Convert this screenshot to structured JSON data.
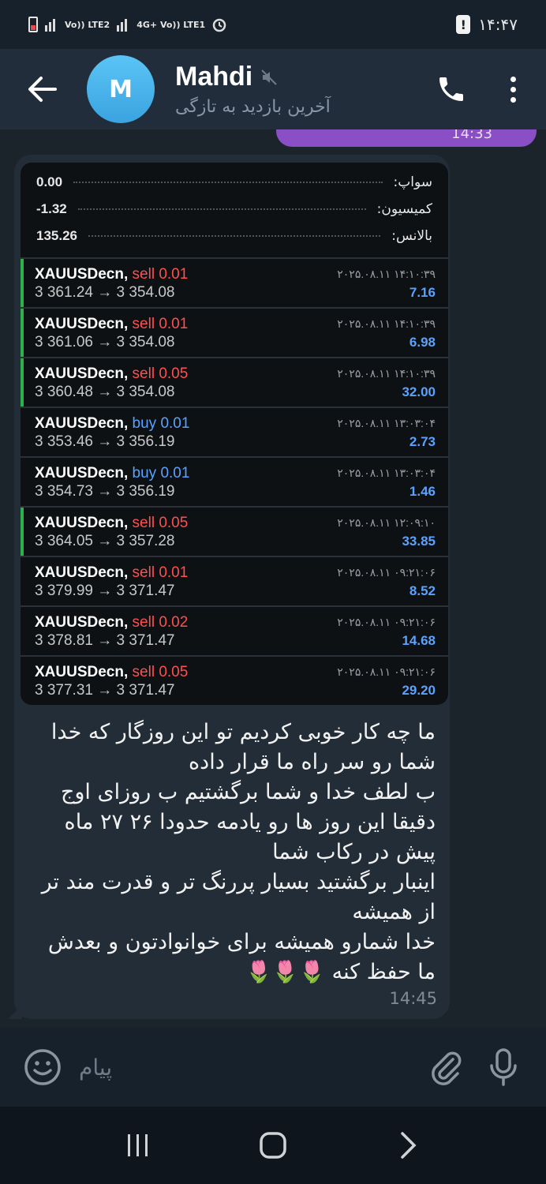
{
  "status_bar": {
    "time": "۱۴:۴۷",
    "network_1": "Vo)) LTE2",
    "network_2": "4G+ Vo)) LTE1"
  },
  "header": {
    "avatar_letter": "M",
    "name": "Mahdi",
    "last_seen": "آخرین بازدید به تازگی"
  },
  "previous_message": {
    "time": "14:33"
  },
  "trade_summary": {
    "swap_label": "سواپ:",
    "swap_value": "0.00",
    "commission_label": "کمیسیون:",
    "commission_value": "-1.32",
    "balance_label": "بالانس:",
    "balance_value": "135.26"
  },
  "trades": [
    {
      "symbol": "XAUUSDecn,",
      "side": "sell",
      "volume": "0.01",
      "prices": "3 361.24 → 3 354.08",
      "date": "۲۰۲۵.۰۸.۱۱ ۱۴:۱۰:۳۹",
      "profit": "7.16",
      "closed": true
    },
    {
      "symbol": "XAUUSDecn,",
      "side": "sell",
      "volume": "0.01",
      "prices": "3 361.06 → 3 354.08",
      "date": "۲۰۲۵.۰۸.۱۱ ۱۴:۱۰:۳۹",
      "profit": "6.98",
      "closed": true
    },
    {
      "symbol": "XAUUSDecn,",
      "side": "sell",
      "volume": "0.05",
      "prices": "3 360.48 → 3 354.08",
      "date": "۲۰۲۵.۰۸.۱۱ ۱۴:۱۰:۳۹",
      "profit": "32.00",
      "closed": true
    },
    {
      "symbol": "XAUUSDecn,",
      "side": "buy",
      "volume": "0.01",
      "prices": "3 353.46 → 3 356.19",
      "date": "۲۰۲۵.۰۸.۱۱ ۱۳:۰۳:۰۴",
      "profit": "2.73",
      "closed": false
    },
    {
      "symbol": "XAUUSDecn,",
      "side": "buy",
      "volume": "0.01",
      "prices": "3 354.73 → 3 356.19",
      "date": "۲۰۲۵.۰۸.۱۱ ۱۳:۰۳:۰۴",
      "profit": "1.46",
      "closed": false
    },
    {
      "symbol": "XAUUSDecn,",
      "side": "sell",
      "volume": "0.05",
      "prices": "3 364.05 → 3 357.28",
      "date": "۲۰۲۵.۰۸.۱۱ ۱۲:۰۹:۱۰",
      "profit": "33.85",
      "closed": true
    },
    {
      "symbol": "XAUUSDecn,",
      "side": "sell",
      "volume": "0.01",
      "prices": "3 379.99 → 3 371.47",
      "date": "۲۰۲۵.۰۸.۱۱ ۰۹:۲۱:۰۶",
      "profit": "8.52",
      "closed": false
    },
    {
      "symbol": "XAUUSDecn,",
      "side": "sell",
      "volume": "0.02",
      "prices": "3 378.81 → 3 371.47",
      "date": "۲۰۲۵.۰۸.۱۱ ۰۹:۲۱:۰۶",
      "profit": "14.68",
      "closed": false
    },
    {
      "symbol": "XAUUSDecn,",
      "side": "sell",
      "volume": "0.05",
      "prices": "3 377.31 → 3 371.47",
      "date": "۲۰۲۵.۰۸.۱۱ ۰۹:۲۱:۰۶",
      "profit": "29.20",
      "closed": false
    }
  ],
  "message": {
    "text": "ما چه کار خوبی کردیم تو این روزگار که خدا شما رو سر راه ما قرار داده\nب لطف خدا و شما برگشتیم ب روزای اوج دقیقا این روز ها رو یادمه حدودا ۲۶ ۲۷ ماه پیش در رکاب شما\nاینبار برگشتید بسیار پررنگ تر و قدرت مند تر از همیشه\nخدا شمارو همیشه برای خوانوادتون و بعدش ما حفظ کنه 🌷🌷🌷",
    "time": "14:45"
  },
  "input": {
    "placeholder": "پیام"
  },
  "colors": {
    "accent_purple": "#8a4fc4",
    "avatar_blue": "#4fb6ee",
    "sell_red": "#ff4f4f",
    "buy_blue": "#5aa2ff",
    "closed_green": "#2bb24c"
  }
}
